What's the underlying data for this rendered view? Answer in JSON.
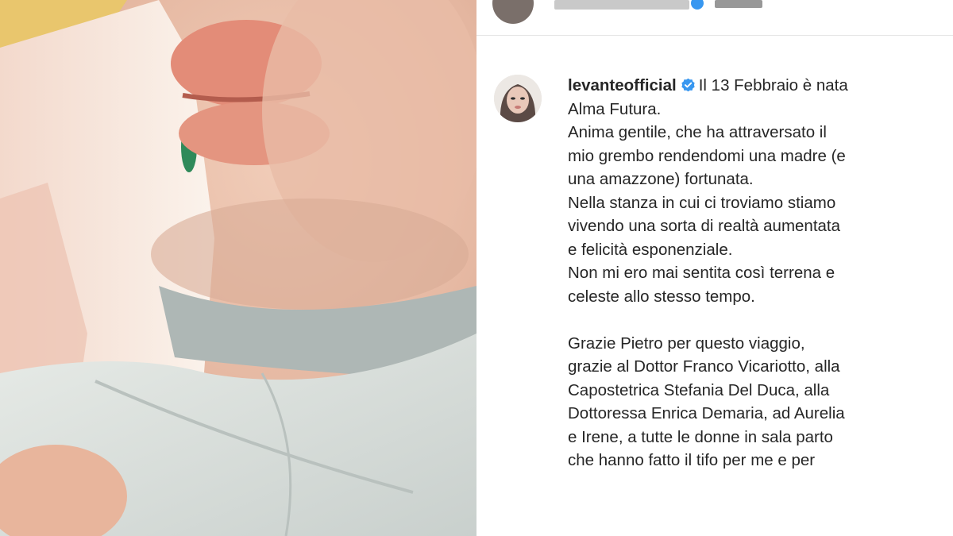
{
  "post": {
    "username": "levanteofficial",
    "icons": {
      "verified": "verified-badge-icon",
      "avatar": "profile-avatar"
    },
    "colors": {
      "verified_blue": "#3897f0",
      "text": "#262626"
    },
    "caption_lines": [
      "Il 13 Febbraio è nata",
      "Alma Futura.",
      "Anima gentile, che ha attraversato il",
      "mio grembo rendendomi una madre (e",
      "una amazzone) fortunata.",
      "Nella stanza in cui ci troviamo stiamo",
      "vivendo una sorta di realtà aumentata",
      "e felicità esponenziale.",
      "Non mi ero mai sentita così terrena e",
      "celeste allo stesso tempo.",
      "Grazie Pietro per questo viaggio,",
      "grazie al Dottor Franco Vicariotto, alla",
      "Capostetrica Stefania Del Duca, alla",
      "Dottoressa Enrica Demaria, ad Aurelia",
      "e Irene, a tutte le donne in sala parto",
      "che hanno fatto il tifo per me e per"
    ]
  }
}
